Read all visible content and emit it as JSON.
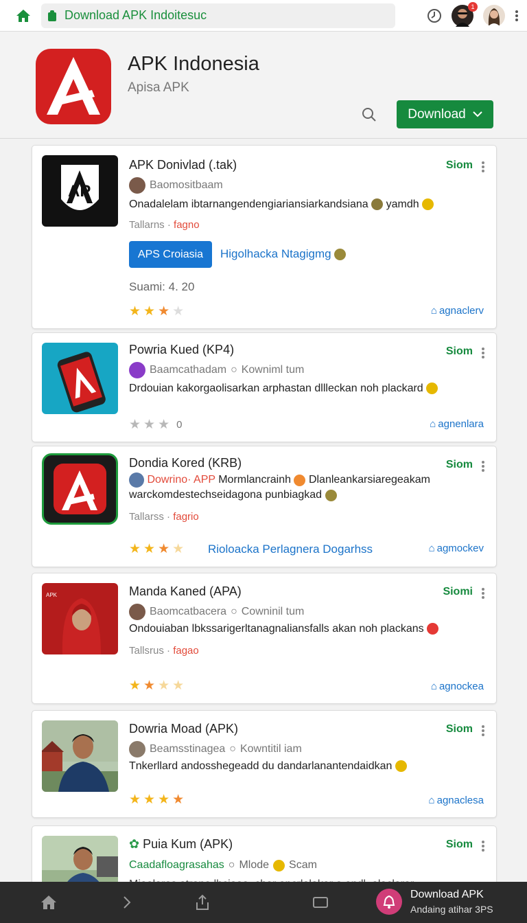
{
  "topbar": {
    "url": "Download APK Indoitesuc",
    "notification_count": "1"
  },
  "app": {
    "title": "APK Indonesia",
    "subtitle": "Apisa APK",
    "download_label": "Download"
  },
  "cards": [
    {
      "title": "APK Donivlad (.tak)",
      "status": "Siom",
      "author": "Baomositbaam",
      "description": "Onadalelam ibtarnangendengiariansiarkandsiana",
      "desc_tail": "yamdh",
      "tag_prefix": "Tallarns ·",
      "tag": "fagno",
      "button_label": "APS Croiasia",
      "blue_link": "Higolhacka Ntagigmg",
      "score": "Suami: 4. 20",
      "rating": 3,
      "link": "agnaclerv"
    },
    {
      "title": "Powria Kued (KP4)",
      "status": "Siom",
      "author": "Baamcathadam",
      "comment": "Kowniml tum",
      "description": "Drdouian kakorgaolisarkan arphastan dllleckan noh plackard",
      "rating_value": "0",
      "rating": 3,
      "link": "agnenlara"
    },
    {
      "title": "Dondia Kored (KRB)",
      "status": "Siom",
      "author_highlight": "Dowrino· APP",
      "author": "Mormlancrainh",
      "description": "Dlanleankarsiaregeakam",
      "description2": "warckomdestechseidagona punbiagkad",
      "tag_prefix": "Tallarss ·",
      "tag": "fagrio",
      "blue_link": "Rioloacka Perlagnera Dogarhss",
      "rating": 3,
      "link": "agmockev"
    },
    {
      "title": "Manda Kaned (APA)",
      "status": "Siomi",
      "author": "Baomcatbacera",
      "comment": "Cowninil tum",
      "description": "Ondouiaban lbkssarigerltanagnaliansfalls akan noh plackans",
      "tag_prefix": "Tallsrus ·",
      "tag": "fagao",
      "rating": 2.5,
      "link": "agnockea"
    },
    {
      "title": "Dowria Moad (APK)",
      "status": "Siom",
      "author": "Beamsstinagea",
      "comment": "Kowntitil iam",
      "description": "Tnkerllard andosshegeadd du dandarlanantendaidkan",
      "rating": 4,
      "link": "agnaclesa"
    },
    {
      "title": "Puia Kum (APK)",
      "status": "Siom",
      "author_highlight": "Caadafloagrasahas",
      "comment": "Mlode",
      "comment2": "Scam",
      "description": "Miaalaras atrana lhciaaa. char apcrlalakar a andl. alaclarar",
      "link": ""
    }
  ],
  "bottombar": {
    "dl_title": "Download APK",
    "dl_sub": "Andaing atihar 3PS"
  }
}
